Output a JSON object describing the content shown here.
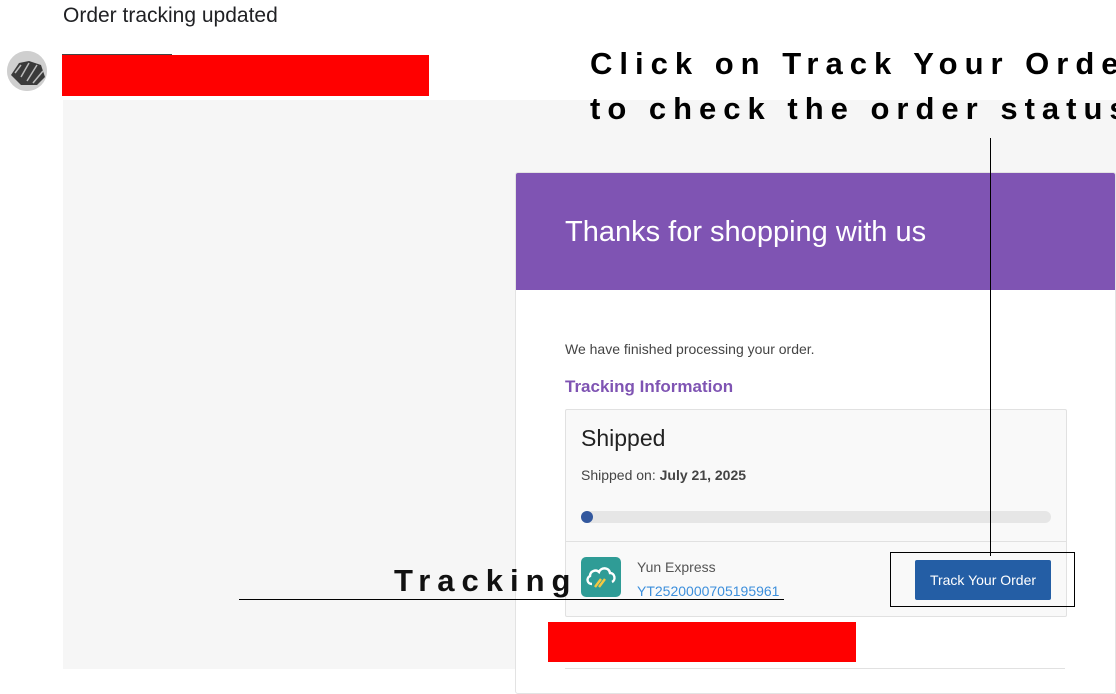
{
  "email": {
    "subject": "Order tracking updated"
  },
  "card": {
    "header_title": "Thanks for shopping with us",
    "intro": "We have finished processing your order.",
    "tracking_heading": "Tracking Information",
    "shipment": {
      "status": "Shipped",
      "shipped_on_label": "Shipped on:",
      "shipped_on_date": "July 21, 2025",
      "progress": 0.0
    },
    "carrier": {
      "name": "Yun Express",
      "tracking_number": "YT2520000705195961",
      "logo_icon": "cloud-truck-icon"
    },
    "track_button_label": "Track Your Order"
  },
  "annotations": {
    "top_line1": "Click on Track Your Order",
    "top_line2": "to check the order status.",
    "tracking_label": "Tracking"
  },
  "colors": {
    "header": "#7f54b3",
    "accent_purple": "#7f54b3",
    "button": "#245ea5",
    "progress": "#33589e",
    "link": "#3d8fdc",
    "redaction": "#ff0000"
  }
}
